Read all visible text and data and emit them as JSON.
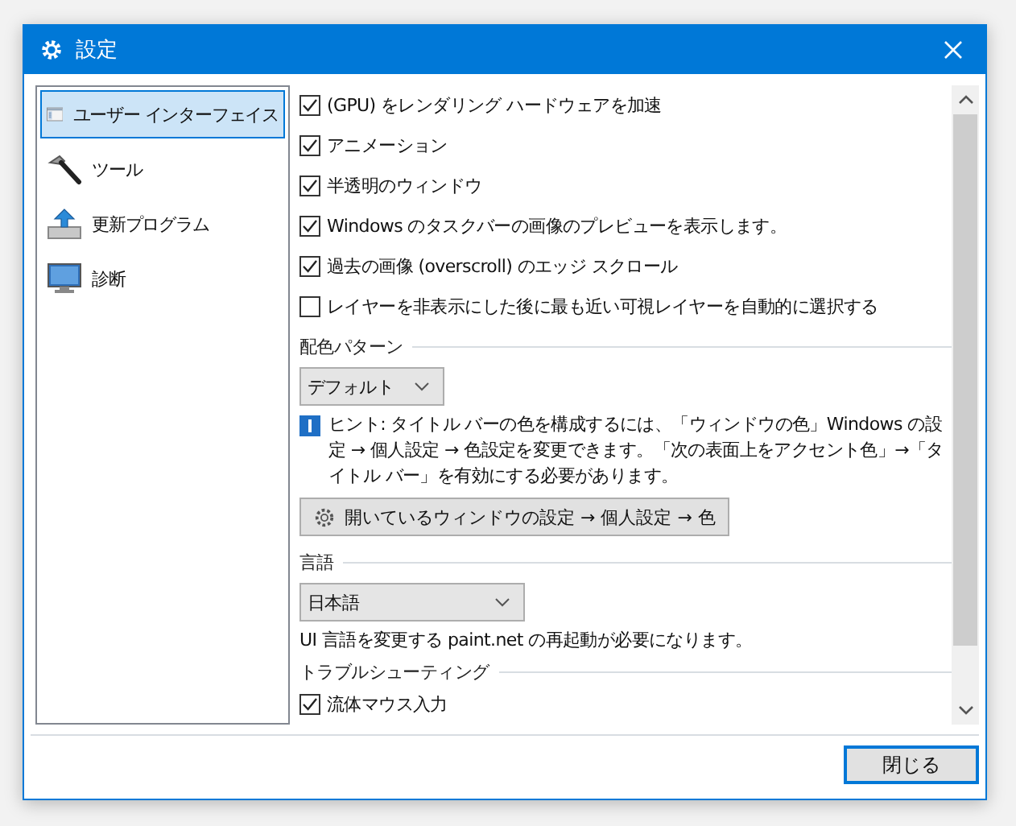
{
  "window": {
    "title": "設定"
  },
  "sidebar": {
    "items": [
      {
        "label": "ユーザー インターフェイス",
        "kind": "window",
        "selected": true
      },
      {
        "label": "ツール",
        "kind": "hammer",
        "selected": false
      },
      {
        "label": "更新プログラム",
        "kind": "update",
        "selected": false
      },
      {
        "label": "診断",
        "kind": "monitor",
        "selected": false
      }
    ]
  },
  "options": [
    {
      "label": "(GPU) をレンダリング ハードウェアを加速",
      "checked": true
    },
    {
      "label": "アニメーション",
      "checked": true
    },
    {
      "label": "半透明のウィンドウ",
      "checked": true
    },
    {
      "label": "Windows のタスクバーの画像のプレビューを表示します。",
      "checked": true
    },
    {
      "label": "過去の画像 (overscroll) のエッジ スクロール",
      "checked": true
    },
    {
      "label": "レイヤーを非表示にした後に最も近い可視レイヤーを自動的に選択する",
      "checked": false
    }
  ],
  "color_scheme": {
    "heading": "配色パターン",
    "dropdown": "デフォルト",
    "hint": "ヒント: タイトル バーの色を構成するには、「ウィンドウの色」Windows の設定 → 個人設定 → 色設定を変更できます。「次の表面上をアクセント色」→「タイトル バー」を有効にする必要があります。",
    "button": "開いているウィンドウの設定 → 個人設定 → 色"
  },
  "language": {
    "heading": "言語",
    "dropdown": "日本語",
    "note": "UI 言語を変更する paint.net の再起動が必要になります。"
  },
  "troubleshooting": {
    "heading": "トラブルシューティング",
    "options": [
      {
        "label": "流体マウス入力",
        "checked": true
      }
    ]
  },
  "buttons": [
    "閉じる"
  ]
}
